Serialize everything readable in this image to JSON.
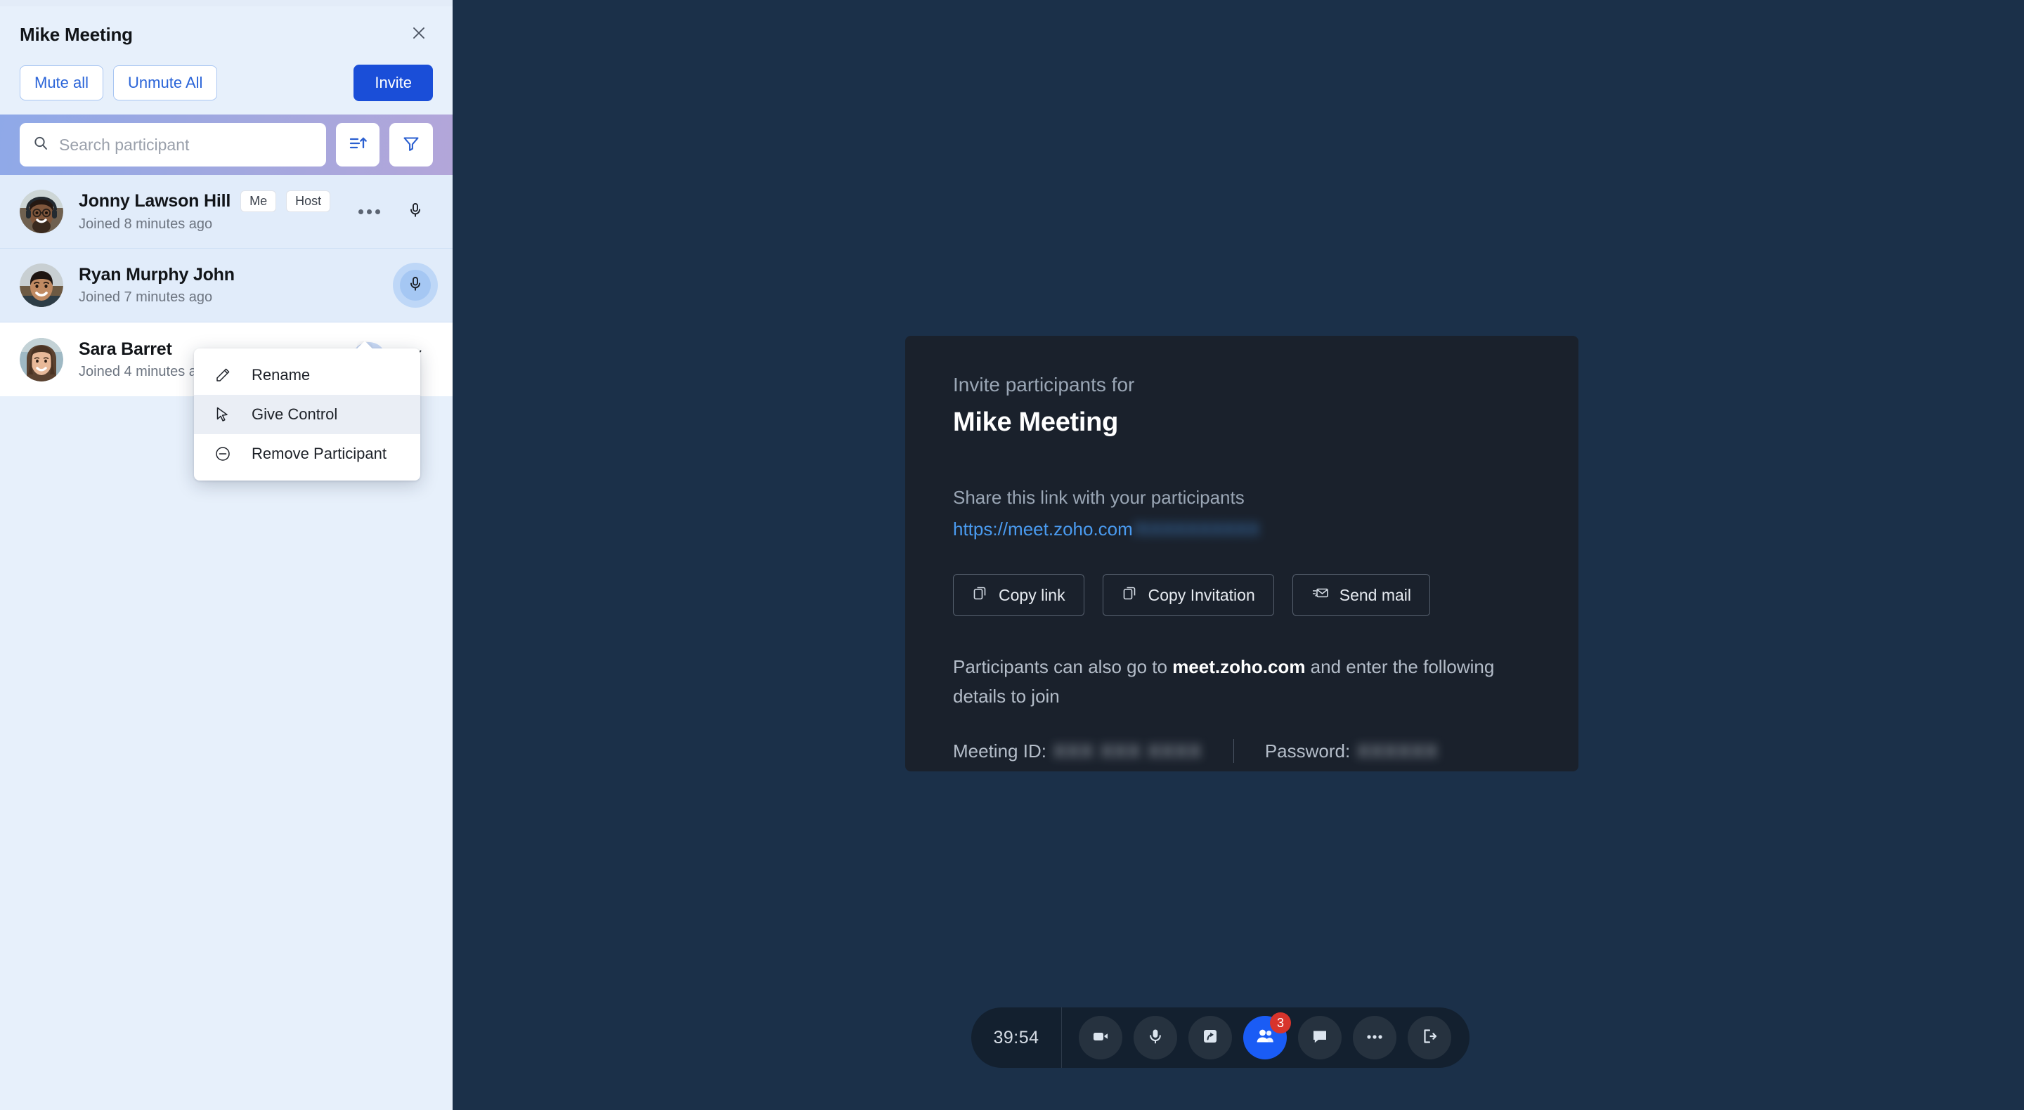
{
  "panel": {
    "title": "Mike Meeting",
    "close_icon": "close-icon",
    "mute_all_label": "Mute all",
    "unmute_all_label": "Unmute All",
    "invite_label": "Invite",
    "search": {
      "placeholder": "Search participant",
      "value": "",
      "search_icon": "search-icon",
      "sort_icon": "sort-icon",
      "filter_icon": "filter-icon"
    },
    "participants": [
      {
        "name": "Jonny Lawson Hill",
        "badges": [
          "Me",
          "Host"
        ],
        "joined": "Joined 8 minutes ago",
        "mic_state": "unmuted",
        "has_more": true,
        "speaking": false,
        "row_state": "default"
      },
      {
        "name": "Ryan Murphy John",
        "badges": [],
        "joined": "Joined 7 minutes ago",
        "mic_state": "unmuted",
        "has_more": false,
        "speaking": true,
        "row_state": "default"
      },
      {
        "name": "Sara Barret",
        "badges": [],
        "joined": "Joined 4 minutes ago",
        "mic_state": "muted",
        "has_more": true,
        "speaking": false,
        "row_state": "active"
      }
    ],
    "context_menu": {
      "items": [
        {
          "label": "Rename",
          "icon": "pencil-icon",
          "highlighted": false
        },
        {
          "label": "Give Control",
          "icon": "cursor-icon",
          "highlighted": true
        },
        {
          "label": "Remove Participant",
          "icon": "minus-circle-icon",
          "highlighted": false
        }
      ]
    }
  },
  "invite_modal": {
    "eyebrow": "Invite participants for",
    "meeting_name": "Mike Meeting",
    "share_label": "Share this link with your participants",
    "link_visible": "https://meet.zoho.com",
    "link_hidden": "/XXXXXXXXXX",
    "buttons": [
      {
        "label": "Copy link",
        "icon": "copy-icon"
      },
      {
        "label": "Copy Invitation",
        "icon": "copy-icon"
      },
      {
        "label": "Send mail",
        "icon": "send-mail-icon"
      }
    ],
    "note_prefix": "Participants can also go to ",
    "note_domain": "meet.zoho.com",
    "note_suffix": " and enter the following details to join",
    "meeting_id_label": "Meeting ID:",
    "meeting_id_value": "XXX XXX XXXX",
    "password_label": "Password:",
    "password_value": "XXXXXX"
  },
  "toolbar": {
    "timer": "39:54",
    "buttons": [
      {
        "name": "camera-button",
        "icon": "camera-icon",
        "active": false,
        "badge": null
      },
      {
        "name": "microphone-button",
        "icon": "microphone-icon",
        "active": false,
        "badge": null
      },
      {
        "name": "share-screen-button",
        "icon": "share-screen-icon",
        "active": false,
        "badge": null
      },
      {
        "name": "participants-button",
        "icon": "participants-icon",
        "active": true,
        "badge": "3"
      },
      {
        "name": "chat-button",
        "icon": "chat-icon",
        "active": false,
        "badge": null
      },
      {
        "name": "more-options-button",
        "icon": "more-icon",
        "active": false,
        "badge": null
      },
      {
        "name": "leave-meeting-button",
        "icon": "exit-icon",
        "active": false,
        "badge": null
      }
    ]
  },
  "colors": {
    "stage_bg": "#1b3049",
    "panel_bg": "#e7f0fb",
    "row_bg": "#e1ecfa",
    "accent_blue": "#1a4ed8",
    "modal_bg": "#1a212c",
    "toolbar_bg": "#13202f",
    "badge_red": "#d8342c",
    "link_blue": "#4a9bf0"
  }
}
